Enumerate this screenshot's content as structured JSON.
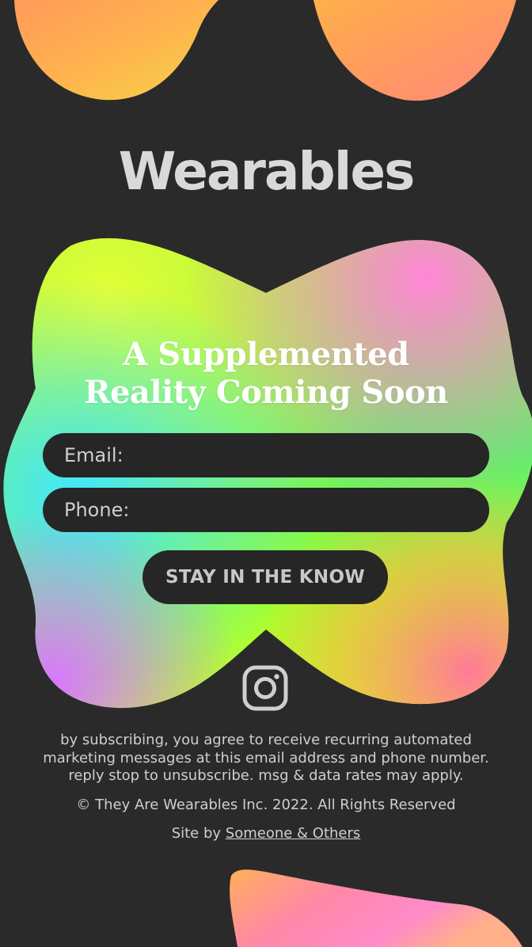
{
  "brand": {
    "logo_text": "Wearables"
  },
  "hero": {
    "headline_line1": "A Supplemented",
    "headline_line2": "Reality Coming Soon"
  },
  "form": {
    "email_placeholder": "Email:",
    "phone_placeholder": "Phone:",
    "submit_label": "STAY IN THE KNOW"
  },
  "social": {
    "icon": "instagram-icon"
  },
  "footer": {
    "disclaimer_line1": "by subscribing, you agree to receive recurring automated",
    "disclaimer_line2": "marketing messages at this email address and phone number.",
    "disclaimer_line3": "reply stop to unsubscribe. msg & data rates may apply.",
    "copyright": "© They Are Wearables Inc. 2022. All Rights Reserved",
    "site_by_prefix": "Site by",
    "site_by_link": "Someone & Others"
  },
  "colors": {
    "background": "#2a2a2a",
    "field_bg": "#262626",
    "text_light": "#cfcfcf"
  }
}
